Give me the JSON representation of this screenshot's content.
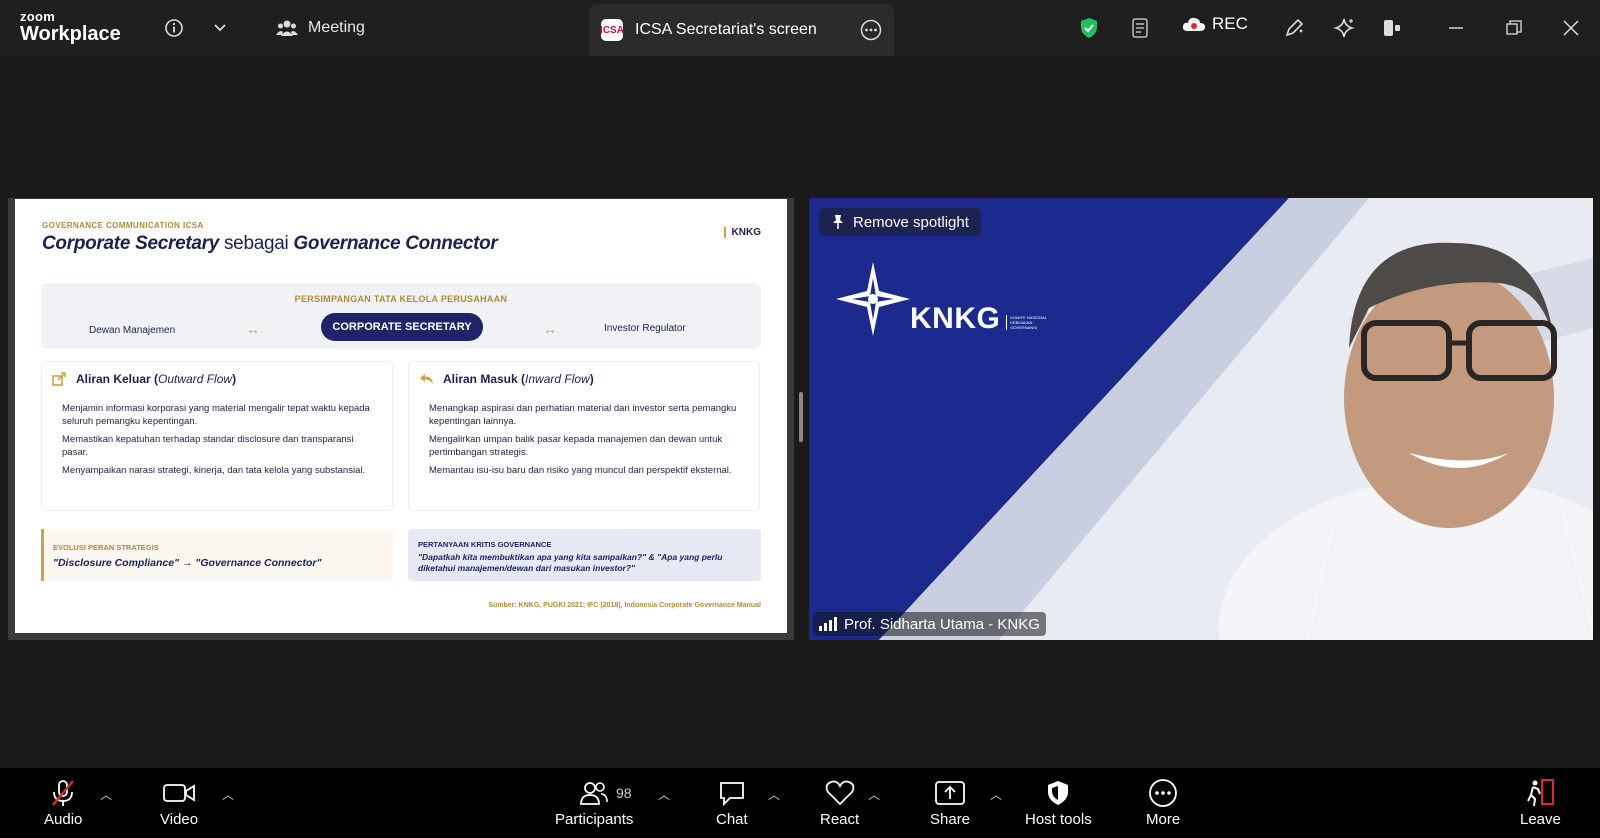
{
  "app": {
    "brand_line1": "zoom",
    "brand_line2": "Workplace"
  },
  "topbar": {
    "meeting_label": "Meeting",
    "screen_tab_label": "ICSA Secretariat's screen",
    "screen_tab_badge": "ICSA",
    "rec_label": "REC",
    "icons": [
      "info-icon",
      "chevron-down-icon",
      "shield-check-icon",
      "notes-icon",
      "cloud-record-icon",
      "annotate-pen-icon",
      "ai-companion-icon",
      "apps-icon",
      "minimize-icon",
      "restore-icon",
      "close-icon"
    ]
  },
  "slide": {
    "kicker": "GOVERNANCE COMMUNICATION ICSA",
    "title_part1": "Corporate Secretary",
    "title_part2": " sebagai ",
    "title_part3": "Governance Connector",
    "brand_tag": "KNKG",
    "junction_label": "PERSIMPANGAN TATA KELOLA PERUSAHAAN",
    "left_party": "Dewan Manajemen",
    "center_party": "CORPORATE SECRETARY",
    "right_party": "Investor Regulator",
    "arrow": "↔",
    "outward": {
      "title": "Aliran Keluar (",
      "title_italic": "Outward Flow",
      "title_end": ")",
      "items": [
        "Menjamin informasi korporasi yang material mengalir tepat waktu kepada seluruh pemangku kepentingan.",
        "Memastikan kepatuhan terhadap standar disclosure dan transparansi pasar.",
        "Menyampaikan narasi strategi, kinerja, dan tata kelola yang substansial."
      ]
    },
    "inward": {
      "title": "Aliran Masuk (",
      "title_italic": "Inward Flow",
      "title_end": ")",
      "items": [
        "Menangkap aspirasi dan perhatian material dari investor serta pemangku kepentingan lainnya.",
        "Mengalirkan umpan balik pasar kepada manajemen dan dewan untuk pertimbangan strategis.",
        "Memantau isu-isu baru dan risiko yang muncul dari perspektif eksternal."
      ]
    },
    "evolution": {
      "label": "EVOLUSI PERAN STRATEGIS",
      "text": "\"Disclosure Compliance\" → \"Governance Connector\""
    },
    "critical": {
      "label": "PERTANYAAN KRITIS GOVERNANCE",
      "text": "\"Dapatkah kita membuktikan apa yang kita sampaikan?\" & \"Apa yang perlu diketahui manajemen/dewan dari masukan investor?\""
    },
    "source": "Sumber: KNKG, PUGKI 2021; IFC (2018), Indonesia Corporate Governance Manual"
  },
  "video": {
    "spotlight_label": "Remove spotlight",
    "logo_word": "KNKG",
    "logo_sub": "KOMITE NASIONAL KEBIJAKAN GOVERNANSI",
    "participant_name": "Prof. Sidharta Utama - KNKG"
  },
  "toolbar": {
    "audio": "Audio",
    "video": "Video",
    "participants": "Participants",
    "participants_count": "98",
    "chat": "Chat",
    "react": "React",
    "share": "Share",
    "host_tools": "Host tools",
    "more": "More",
    "leave": "Leave"
  },
  "colors": {
    "accent_navy": "#1d2469",
    "gold": "#c9a24a",
    "leave_red": "#e02828",
    "shield_green": "#1fc25a"
  }
}
